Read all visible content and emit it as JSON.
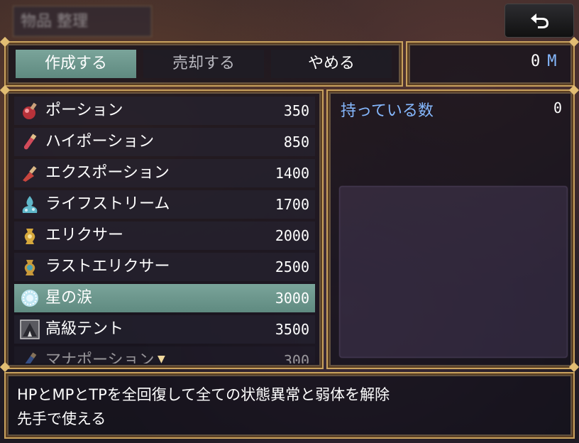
{
  "background_window": {
    "title": "物品 整理"
  },
  "back_button": {
    "icon": "return-arrow-icon"
  },
  "commands": [
    {
      "label": "作成する",
      "selected": true
    },
    {
      "label": "売却する",
      "selected": false
    },
    {
      "label": "やめる",
      "selected": false
    }
  ],
  "gold": {
    "amount": "0",
    "unit": "M"
  },
  "items": [
    {
      "name": "ポーション",
      "price": "350",
      "icon": "red-potion-icon"
    },
    {
      "name": "ハイポーション",
      "price": "850",
      "icon": "vial-icon"
    },
    {
      "name": "エクスポーション",
      "price": "1400",
      "icon": "flask-icon"
    },
    {
      "name": "ライフストリーム",
      "price": "1700",
      "icon": "fountain-icon"
    },
    {
      "name": "エリクサー",
      "price": "2000",
      "icon": "golden-urn-icon"
    },
    {
      "name": "ラストエリクサー",
      "price": "2500",
      "icon": "blue-urn-icon"
    },
    {
      "name": "星の涙",
      "price": "3000",
      "icon": "star-tear-icon",
      "selected": true
    },
    {
      "name": "高級テント",
      "price": "3500",
      "icon": "tent-icon"
    },
    {
      "name": "マナポーション",
      "price": "300",
      "icon": "mana-vial-icon"
    }
  ],
  "status": {
    "owned_label": "持っている数",
    "owned_value": "0"
  },
  "help": {
    "line1": "HPとMPとTPを全回復して全ての状態異常と弱体を解除",
    "line2": "先手で使える"
  },
  "colors": {
    "accent": "#86b9ff",
    "selection": "#6e978d",
    "frame": "#c9a25e"
  }
}
